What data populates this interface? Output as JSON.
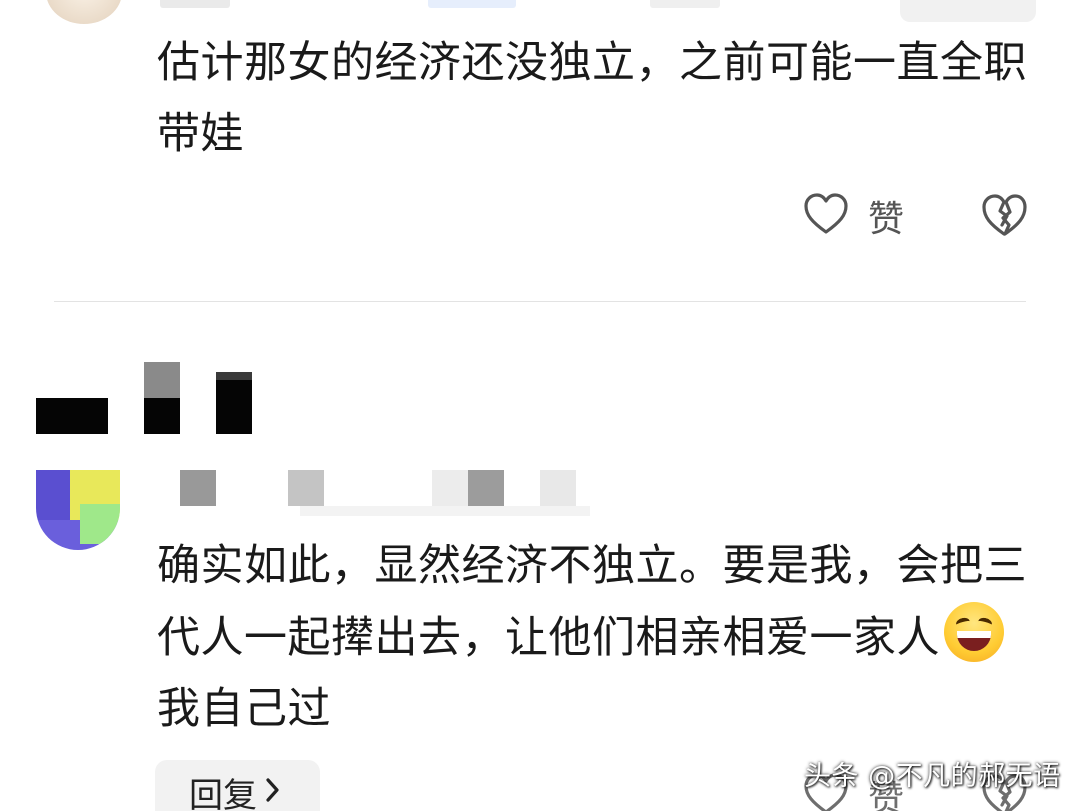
{
  "comment_1": {
    "text": "估计那女的经济还没独立，之前可能一直全职带娃",
    "like_label": "赞"
  },
  "comment_2": {
    "text_before_emoji": "确实如此，显然经济不独立。要是我，会把三代人一起撵出去，让他们相亲相爱一家人",
    "emoji": "laughing-face",
    "text_after_emoji": "我自己过",
    "reply_label": "回复",
    "like_label": "赞"
  },
  "watermark": "头条 @不凡的郝无语",
  "colors": {
    "text": "#1a1a1a",
    "icon": "#555555",
    "divider": "#e3e3e3",
    "reply_bg": "#f2f2f2"
  }
}
